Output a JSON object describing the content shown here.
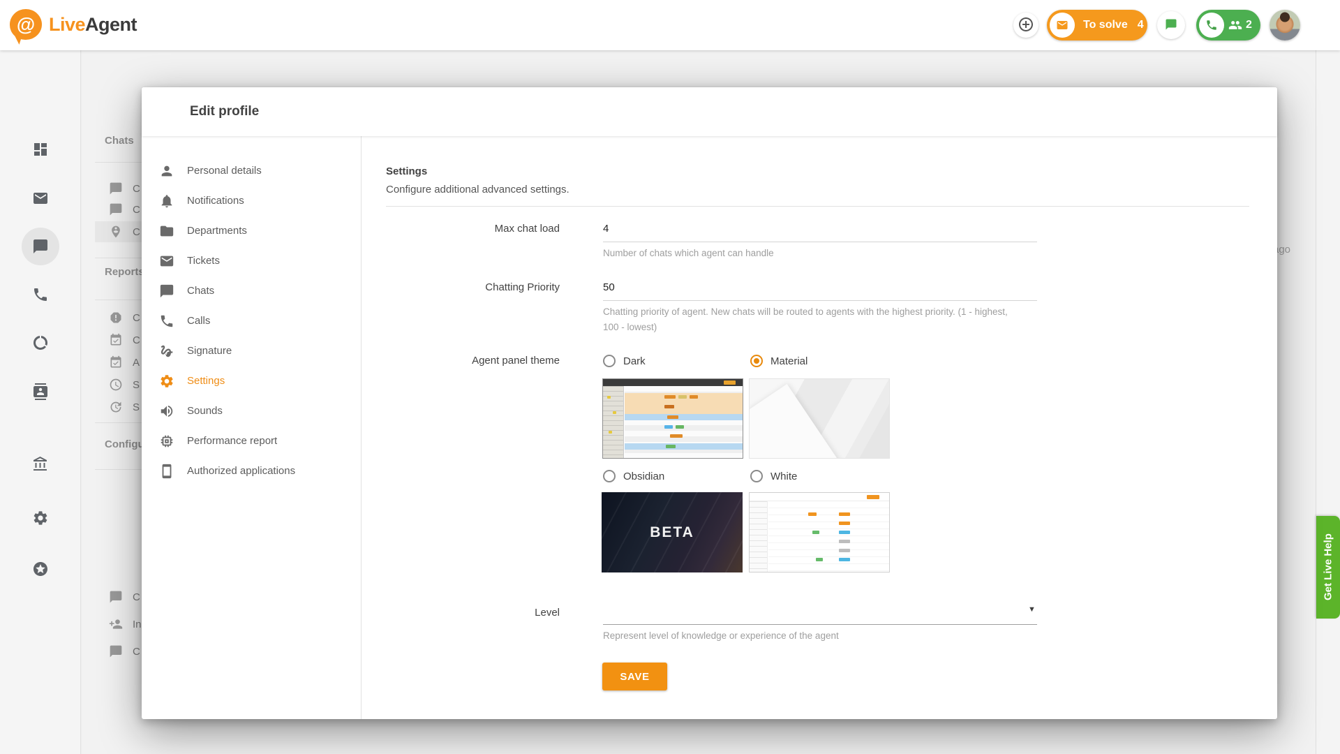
{
  "header": {
    "logo_live": "Live",
    "logo_agent": "Agent",
    "to_solve_label": "To solve",
    "to_solve_count": "4",
    "calls_count": "2"
  },
  "background": {
    "sections": [
      {
        "title": "Chats",
        "items": [
          "C",
          "C",
          "C"
        ]
      },
      {
        "title": "Reports",
        "items": [
          "C",
          "C",
          "A",
          "S",
          "S"
        ]
      },
      {
        "title": "Configu",
        "items": [
          "C",
          "In",
          "C"
        ]
      }
    ],
    "time_ago": "ago"
  },
  "live_help": {
    "label": "Get Live Help"
  },
  "modal": {
    "title": "Edit profile",
    "menu": [
      {
        "label": "Personal details"
      },
      {
        "label": "Notifications"
      },
      {
        "label": "Departments"
      },
      {
        "label": "Tickets"
      },
      {
        "label": "Chats"
      },
      {
        "label": "Calls"
      },
      {
        "label": "Signature"
      },
      {
        "label": "Settings"
      },
      {
        "label": "Sounds"
      },
      {
        "label": "Performance report"
      },
      {
        "label": "Authorized applications"
      }
    ],
    "section_title": "Settings",
    "section_subtitle": "Configure additional advanced settings.",
    "max_chat_load": {
      "label": "Max chat load",
      "value": "4",
      "helper": "Number of chats which agent can handle"
    },
    "chatting_priority": {
      "label": "Chatting Priority",
      "value": "50",
      "helper": "Chatting priority of agent. New chats will be routed to agents with the highest priority. (1 - highest, 100 - lowest)"
    },
    "theme": {
      "label": "Agent panel theme",
      "dark": "Dark",
      "material": "Material",
      "obsidian": "Obsidian",
      "white": "White",
      "beta": "BETA"
    },
    "level": {
      "label": "Level",
      "helper": "Represent level of knowledge or experience of the agent"
    },
    "save_label": "SAVE"
  },
  "colors": {
    "brand_orange": "#F6921E",
    "save_orange": "#F29111",
    "active_orange": "#EF8D16",
    "green": "#4CAF50",
    "live_help_green": "#5CB42A"
  }
}
